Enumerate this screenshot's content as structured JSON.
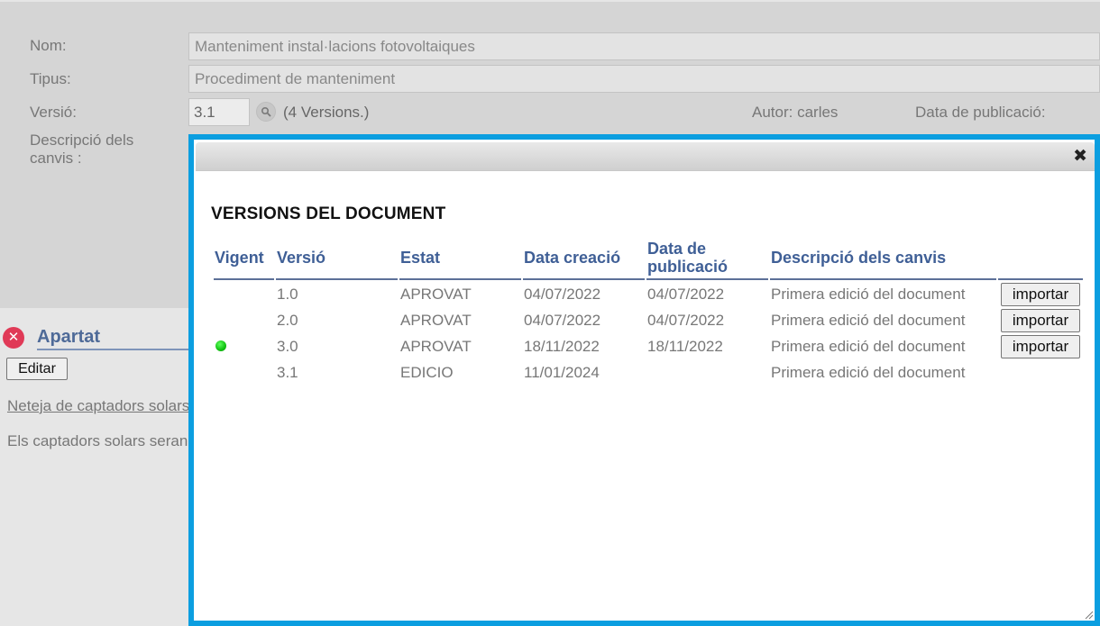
{
  "form": {
    "nom_label": "Nom:",
    "nom_value": "Manteniment instal·lacions fotovoltaiques",
    "tipus_label": "Tipus:",
    "tipus_value": "Procediment de manteniment",
    "versio_label": "Versió:",
    "versio_value": "3.1",
    "versions_count": "(4 Versions.)",
    "autor": "Autor: carles",
    "data_publicacio_label": "Data de publicació:",
    "descripcio_label_1": "Descripció dels",
    "descripcio_label_2": "canvis :"
  },
  "apartat": {
    "title": "Apartat",
    "editar_label": "Editar",
    "link_text": "Neteja de captadors solars",
    "text": "Els captadors solars seran"
  },
  "modal": {
    "close_glyph": "✖",
    "heading": "VERSIONS DEL DOCUMENT",
    "columns": {
      "vigent": "Vigent",
      "versio": "Versió",
      "estat": "Estat",
      "data_creacio": "Data creació",
      "data_publicacio_1": "Data de",
      "data_publicacio_2": "publicació",
      "descripcio": "Descripció dels canvis"
    },
    "rows": [
      {
        "versio": "1.0",
        "estat": "APROVAT",
        "data_creacio": "04/07/2022",
        "data_publicacio": "04/07/2022",
        "descripcio": "Primera edició del document",
        "import_label": "importar"
      },
      {
        "versio": "2.0",
        "estat": "APROVAT",
        "data_creacio": "04/07/2022",
        "data_publicacio": "04/07/2022",
        "descripcio": "Primera edició del document",
        "import_label": "importar"
      },
      {
        "versio": "3.0",
        "estat": "APROVAT",
        "data_creacio": "18/11/2022",
        "data_publicacio": "18/11/2022",
        "descripcio": "Primera edició del document",
        "import_label": "importar"
      },
      {
        "versio": "3.1",
        "estat": "EDICIO",
        "data_creacio": "11/01/2024",
        "data_publicacio": "",
        "descripcio": "Primera edició del document"
      }
    ]
  },
  "colors": {
    "modal_border": "#0b9ee0",
    "header_text": "#3f5f96",
    "vigent_dot": "#10c010",
    "close_circle": "#e03a57"
  }
}
